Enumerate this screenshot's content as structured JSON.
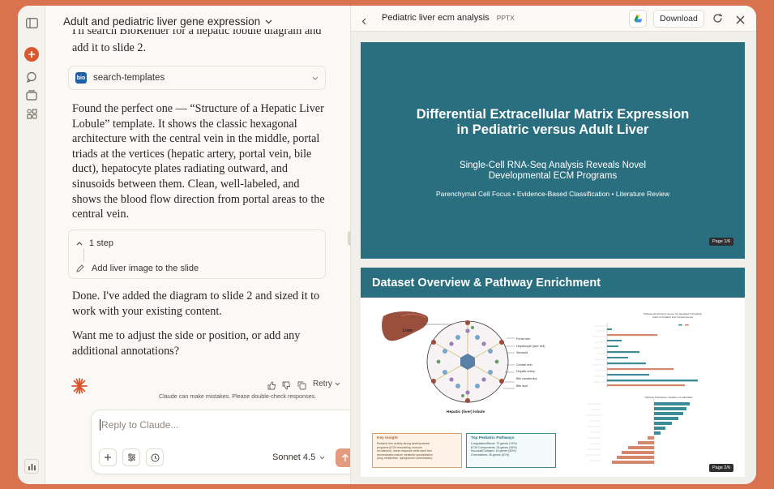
{
  "chat": {
    "title": "Adult and pediatric liver gene expression",
    "intro_clipped": "I'll search BioRender for a hepatic lobule diagram and",
    "intro_line2": "add it to slide 2.",
    "tool_name": "search-templates",
    "tool_logo": "bio",
    "found_lines": [
      "Found the perfect one — “Structure of a Hepatic Liver",
      "Lobule” template. It shows the classic hexagonal",
      "architecture with the central vein in the middle, portal",
      "triads at the vertices (hepatic artery, portal vein, bile",
      "duct), hepatocyte plates radiating outward, and",
      "sinusoids between them. Clean, well-labeled, and",
      "shows the blood flow direction from portal areas to the",
      "central vein."
    ],
    "steps_count": "1 step",
    "step_action": "Add liver image to the slide",
    "done_lines": [
      "Done. I've added the diagram to slide 2 and sized it to",
      "work with your existing content."
    ],
    "question_lines": [
      "Want me to adjust the side or position, or add any",
      "additional annotations?"
    ],
    "retry_label": "Retry",
    "disclaimer": "Claude can make mistakes. Please double-check responses.",
    "input_placeholder": "Reply to Claude...",
    "model_label": "Sonnet 4.5"
  },
  "viewer": {
    "file_title": "Pediatric liver ecm analysis",
    "file_type": "PPTX",
    "download_label": "Download",
    "slide1": {
      "title_line1": "Differential Extracellular Matrix Expression",
      "title_line2": "in Pediatric versus Adult Liver",
      "subtitle_line1": "Single-Cell RNA-Seq Analysis Reveals Novel",
      "subtitle_line2": "Developmental ECM Programs",
      "tagline": "Parenchymal Cell Focus • Evidence-Based Classification • Literature Review",
      "page": "Page 1/6"
    },
    "slide2": {
      "title": "Dataset Overview & Pathway Enrichment",
      "liver_label": "Liver",
      "lobule_label": "Hepatic (liver) lobule",
      "diagram_labels": [
        "Portal vein",
        "Hepatocyte (liver cell)",
        "Sinusoid",
        "Central vein",
        "Hepatic artery",
        "Bile canaliculus",
        "Bile duct"
      ],
      "key_insight_title": "Key Insight",
      "key_insight_lines": [
        "Pediatric liver activity strong developmental",
        "programs (ECM remodeling, immune",
        "recruitment), stress response while adult liver",
        "demonstrates mature metabolic specialization",
        "(drug metabolism, lipid/glucose homeostasis)."
      ],
      "top_pathways_title": "Top Pediatric Pathways",
      "top_pathways_lines": [
        "Coagulation/Blood: 79 genes (78%)",
        "ECM Components: 28 genes (95%)",
        "Mucosal/Collagen: 16 genes (50%)",
        "Chemokines: 38 genes (61%)"
      ],
      "chart1_title_line1": "Pathway Enrichment: Genes Up-regulated in Pediatric",
      "chart1_title_line2": "Adult vs Pediatric liver transcriptomes",
      "chart2_title": "Pathway Distribution: Pediatric vs Adult Bias",
      "page": "Page 2/6"
    },
    "colors": {
      "teal": "#2a6f7f",
      "accent": "#d9724f",
      "orange_bar": "#d4876b",
      "teal_bar": "#3c8c98"
    }
  }
}
